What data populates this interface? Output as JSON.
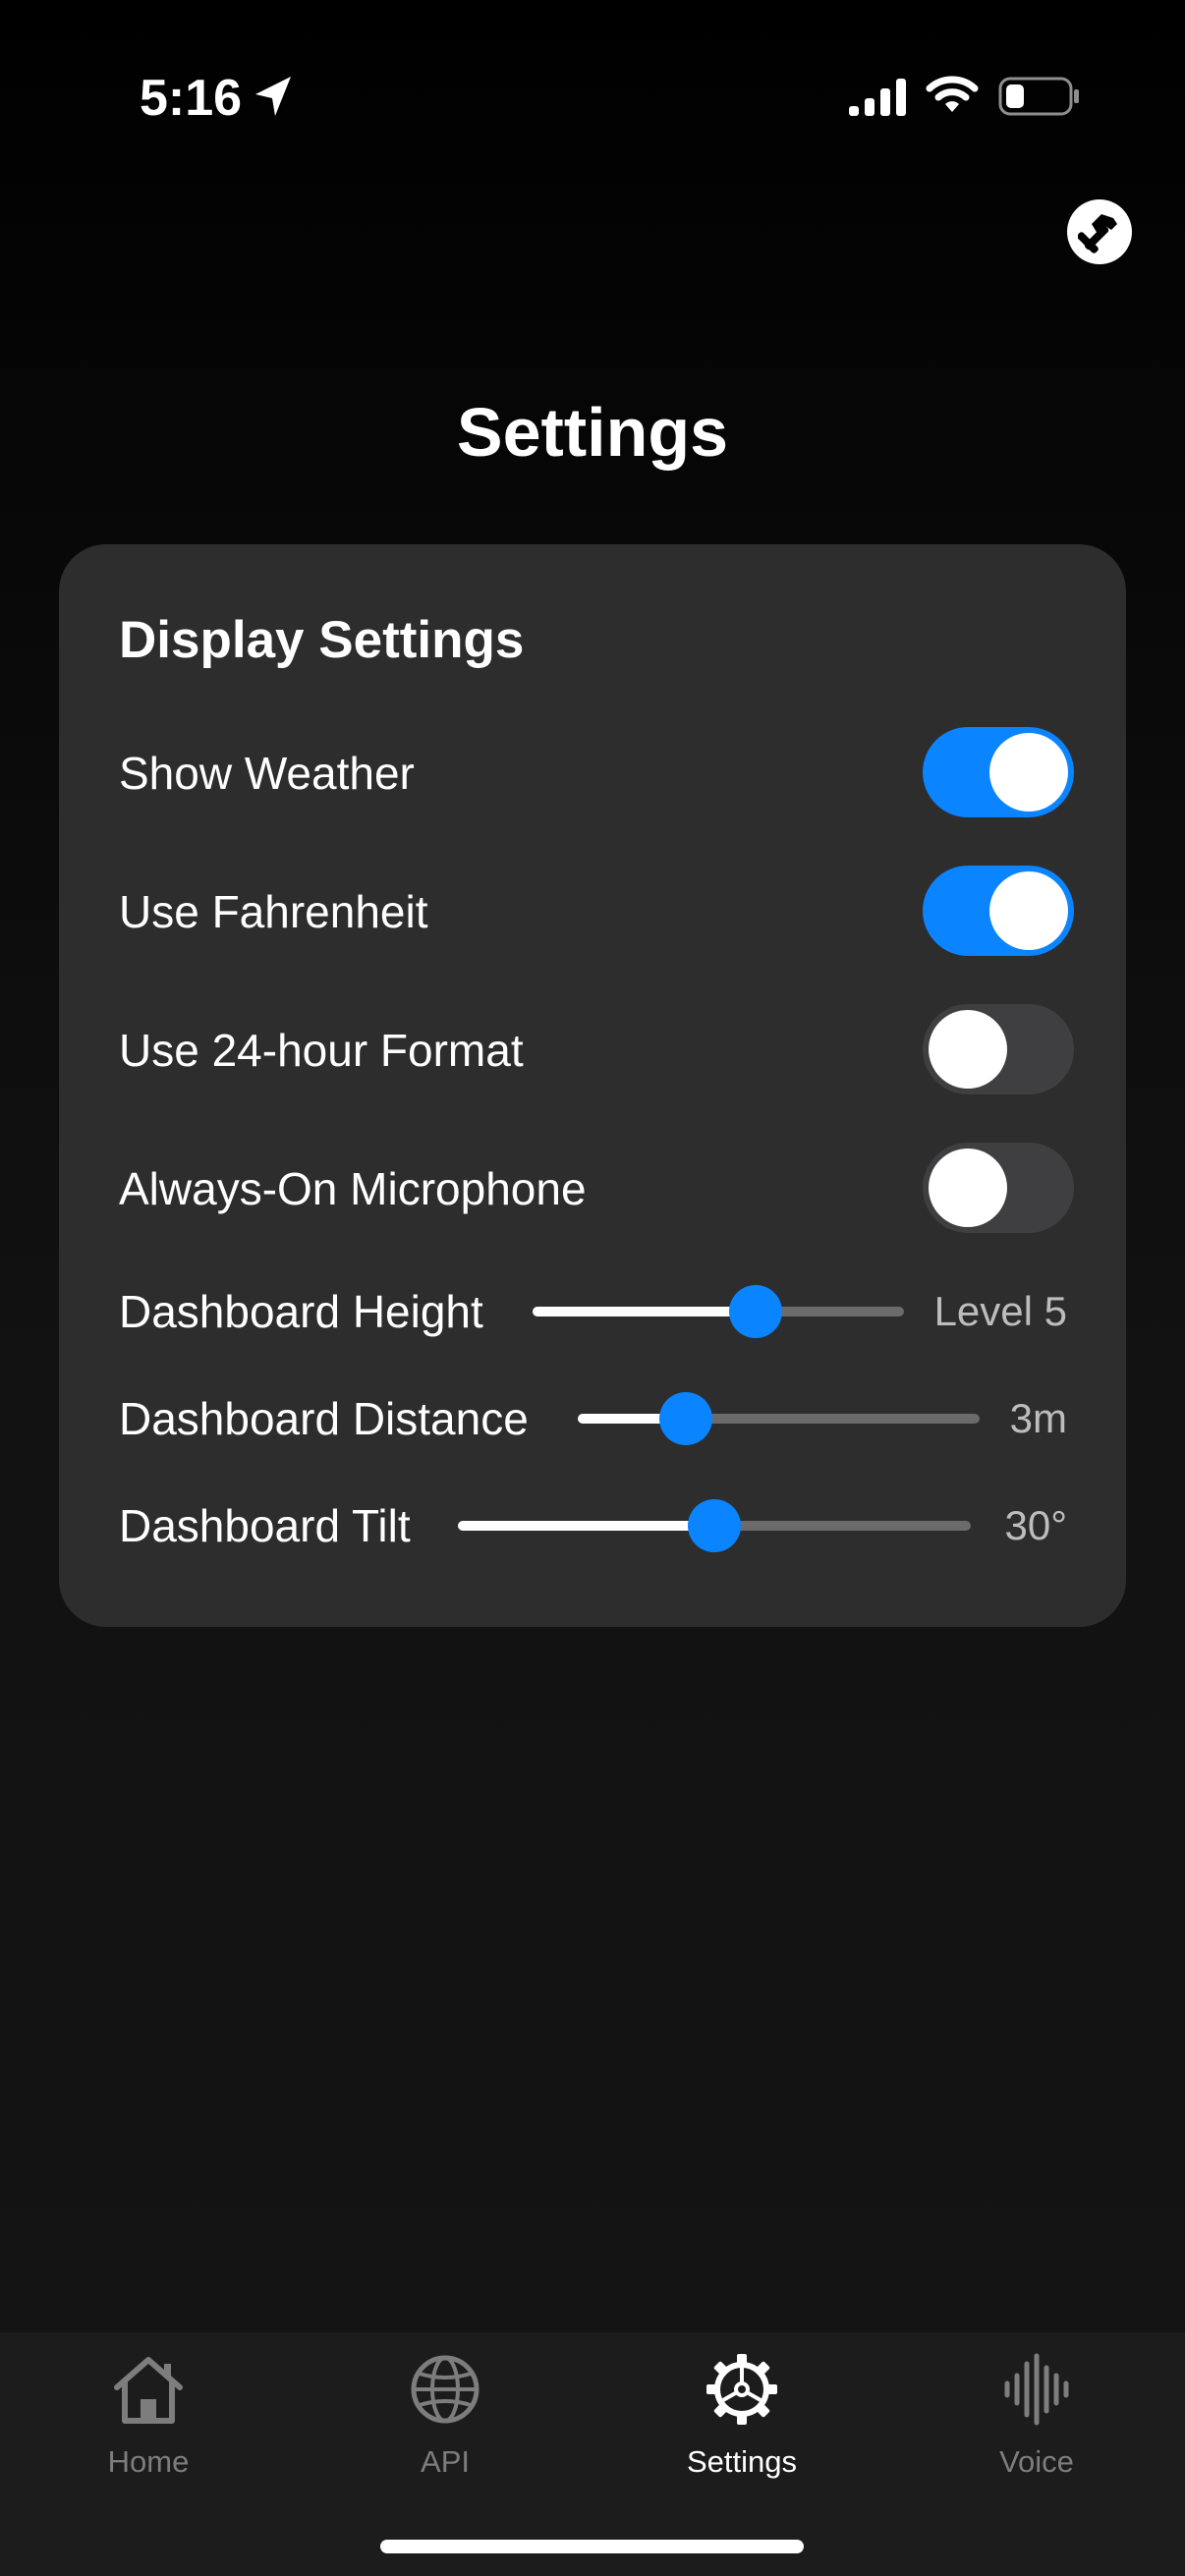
{
  "status_bar": {
    "time": "5:16",
    "icons": [
      "location-arrow-icon",
      "cellular-signal-icon",
      "wifi-icon",
      "battery-icon"
    ]
  },
  "header": {
    "title": "Settings",
    "tools_icon": "hammer-icon"
  },
  "card": {
    "title": "Display Settings",
    "toggles": [
      {
        "label": "Show Weather",
        "on": true
      },
      {
        "label": "Use Fahrenheit",
        "on": true
      },
      {
        "label": "Use 24-hour Format",
        "on": false
      },
      {
        "label": "Always-On Microphone",
        "on": false
      }
    ],
    "sliders": [
      {
        "label": "Dashboard Height",
        "value_text": "Level 5",
        "fraction": 0.6
      },
      {
        "label": "Dashboard Distance",
        "value_text": "3m",
        "fraction": 0.27
      },
      {
        "label": "Dashboard Tilt",
        "value_text": "30°",
        "fraction": 0.5
      }
    ]
  },
  "tab_bar": {
    "tabs": [
      {
        "label": "Home",
        "icon": "house-icon",
        "active": false
      },
      {
        "label": "API",
        "icon": "globe-icon",
        "active": false
      },
      {
        "label": "Settings",
        "icon": "gear-icon",
        "active": true
      },
      {
        "label": "Voice",
        "icon": "waveform-icon",
        "active": false
      }
    ]
  },
  "colors": {
    "accent": "#0a84ff",
    "card_background": "#2d2d2d",
    "toggle_off": "#3f3f41",
    "tab_inactive": "#7d7d7d"
  }
}
